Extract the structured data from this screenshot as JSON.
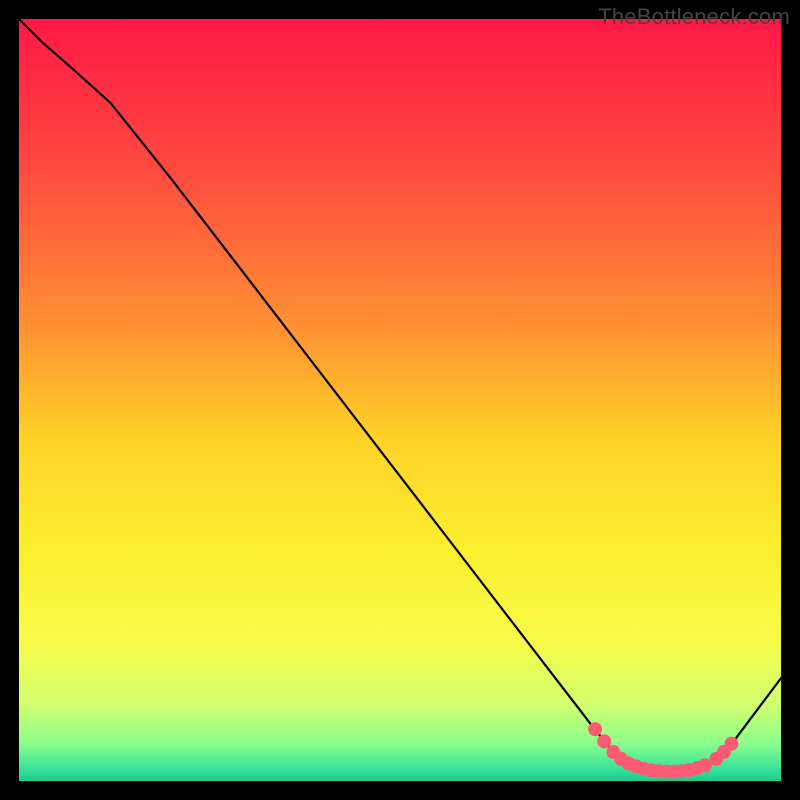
{
  "watermark": "TheBottleneck.com",
  "chart_data": {
    "type": "line",
    "title": "",
    "xlabel": "",
    "ylabel": "",
    "xlim": [
      0,
      100
    ],
    "ylim": [
      0,
      100
    ],
    "grid": false,
    "legend": false,
    "background_gradient": {
      "stops": [
        {
          "offset": 0.0,
          "color": "#ff1846"
        },
        {
          "offset": 0.2,
          "color": "#ff4b3e"
        },
        {
          "offset": 0.4,
          "color": "#ff8f33"
        },
        {
          "offset": 0.55,
          "color": "#ffd228"
        },
        {
          "offset": 0.7,
          "color": "#fbef2e"
        },
        {
          "offset": 0.82,
          "color": "#f6fb4a"
        },
        {
          "offset": 0.9,
          "color": "#d1ff6e"
        },
        {
          "offset": 0.95,
          "color": "#8bff8b"
        },
        {
          "offset": 0.985,
          "color": "#36e29a"
        },
        {
          "offset": 1.0,
          "color": "#1cc98f"
        }
      ]
    },
    "series": [
      {
        "name": "curve",
        "type": "line",
        "color": "#000000",
        "x": [
          0,
          3,
          7,
          12,
          20,
          30,
          40,
          50,
          60,
          70,
          75,
          78,
          80,
          82,
          84,
          86,
          88,
          90,
          92,
          94,
          100
        ],
        "y": [
          100,
          97,
          93.5,
          89,
          79,
          66,
          53,
          40,
          27,
          14,
          7.5,
          3.8,
          2.3,
          1.5,
          1.2,
          1.2,
          1.4,
          1.9,
          3.2,
          5.5,
          13.5
        ]
      },
      {
        "name": "optimal-range",
        "type": "scatter",
        "color": "#ff5a74",
        "marker_size": 7,
        "x": [
          75.6,
          76.8,
          78.0,
          79.0,
          80.0,
          81.0,
          82.0,
          83.0,
          84.0,
          85.0,
          86.0,
          87.0,
          88.0,
          89.0,
          90.0,
          91.5,
          92.5,
          93.5
        ],
        "y": [
          6.8,
          5.2,
          3.8,
          2.9,
          2.3,
          1.9,
          1.6,
          1.4,
          1.3,
          1.25,
          1.25,
          1.3,
          1.45,
          1.7,
          2.05,
          2.9,
          3.8,
          4.9
        ]
      }
    ]
  }
}
